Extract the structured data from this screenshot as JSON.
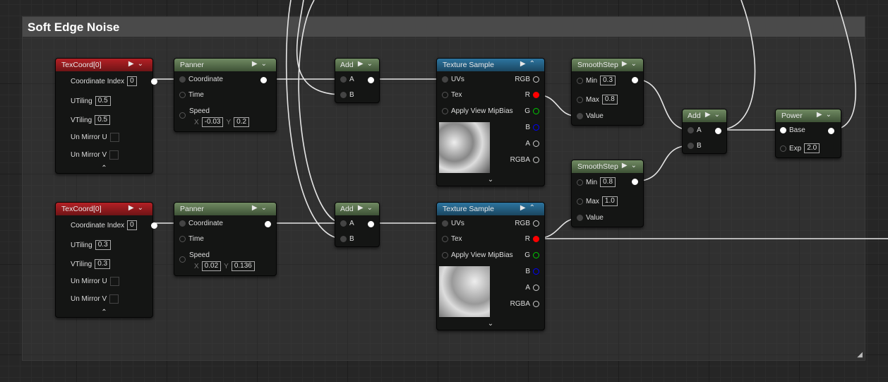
{
  "comment": {
    "title": "Soft Edge Noise"
  },
  "texcoord": [
    {
      "title": "TexCoord[0]",
      "coordinate_index_label": "Coordinate Index",
      "coordinate_index": "0",
      "utiling_label": "UTiling",
      "utiling": "0.5",
      "vtiling_label": "VTiling",
      "vtiling": "0.5",
      "unmirror_u_label": "Un Mirror U",
      "unmirror_v_label": "Un Mirror V",
      "unmirror_u": false,
      "unmirror_v": false
    },
    {
      "title": "TexCoord[0]",
      "coordinate_index_label": "Coordinate Index",
      "coordinate_index": "0",
      "utiling_label": "UTiling",
      "utiling": "0.3",
      "vtiling_label": "VTiling",
      "vtiling": "0.3",
      "unmirror_u_label": "Un Mirror U",
      "unmirror_v_label": "Un Mirror V",
      "unmirror_u": false,
      "unmirror_v": false
    }
  ],
  "panner": [
    {
      "title": "Panner",
      "coordinate": "Coordinate",
      "time": "Time",
      "speed": "Speed",
      "x_label": "X",
      "x": "-0.03",
      "y_label": "Y",
      "y": "0.2"
    },
    {
      "title": "Panner",
      "coordinate": "Coordinate",
      "time": "Time",
      "speed": "Speed",
      "x_label": "X",
      "x": "0.02",
      "y_label": "Y",
      "y": "0.136"
    }
  ],
  "add": [
    {
      "title": "Add",
      "a": "A",
      "b": "B"
    },
    {
      "title": "Add",
      "a": "A",
      "b": "B"
    },
    {
      "title": "Add",
      "a": "A",
      "b": "B"
    }
  ],
  "texture_sample": [
    {
      "title": "Texture Sample",
      "uvs": "UVs",
      "tex": "Tex",
      "mip": "Apply View MipBias",
      "rgb": "RGB",
      "r": "R",
      "g": "G",
      "b": "B",
      "a": "A",
      "rgba": "RGBA"
    },
    {
      "title": "Texture Sample",
      "uvs": "UVs",
      "tex": "Tex",
      "mip": "Apply View MipBias",
      "rgb": "RGB",
      "r": "R",
      "g": "G",
      "b": "B",
      "a": "A",
      "rgba": "RGBA"
    }
  ],
  "smoothstep": [
    {
      "title": "SmoothStep",
      "min_label": "Min",
      "min": "0.3",
      "max_label": "Max",
      "max": "0.8",
      "value": "Value"
    },
    {
      "title": "SmoothStep",
      "min_label": "Min",
      "min": "0.8",
      "max_label": "Max",
      "max": "1.0",
      "value": "Value"
    }
  ],
  "power": {
    "title": "Power",
    "base": "Base",
    "exp_label": "Exp",
    "exp": "2.0"
  },
  "colors": {
    "r_pin": "#ff0000",
    "g_pin": "#00c800",
    "b_pin": "#0000ff",
    "texcoord_header": "#b52025",
    "math_header": "#708a62",
    "texture_header": "#2d75a0"
  }
}
